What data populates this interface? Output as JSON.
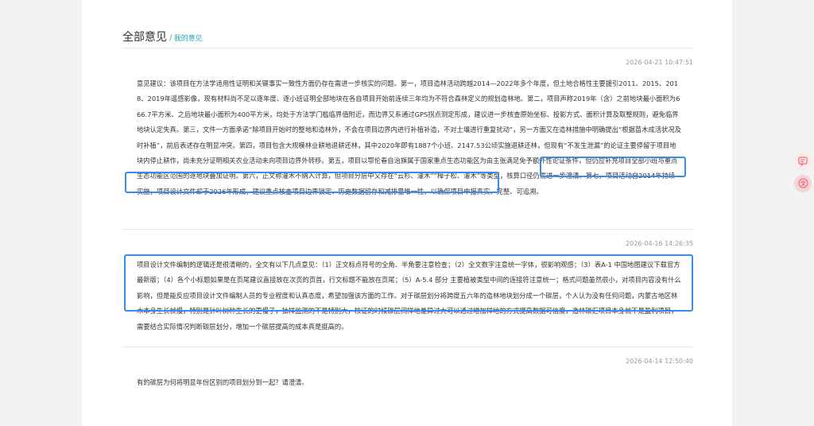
{
  "header": {
    "title": "全部意见",
    "separator": "/",
    "subtitle": "我的意见"
  },
  "opinions": [
    {
      "timestamp": "2026-04-21 10:47:51",
      "text": "意见建议：该项目在方法学适用性证明和关键事实一致性方面仍存在需进一步核实的问题。第一，项目造林活动跨越2014—2022年多个年度，但土地合格性主要援引2011、2015、2018、2019年遥感影像，现有材料尚不足以逐年度、逐小班证明全部地块在各自项目开始前连续三年均为不符合森林定义的规划造林地。第二，项目声称2019年（含）之前地块最小面积为666.7平方米、之后地块最小面积为400平方米，均处于方法学门槛临界值附近，而边界又系通过GPS拐点测定形成，建议进一步核查原始坐标、投影方式、面积计算及取整规则，避免临界地块认定失真。第三，文件一方面承诺“除项目开始时的整地和造林外，不会在项目边界内进行补植补造，不对土壤进行重复扰动”，另一方面又在造林措施中明确提出“根据苗木成活状况及时补植”，前后表述存在明显冲突。第四，项目包含大规模林业耕地退耕还林，其中2020年即有1887个小班、2147.53公顷实施退耕还林，但现有“不发生泄漏”的论证主要停留于项目地块内停止耕作，尚未充分证明相关农业活动未向项目边界外转移。第五，项目以鄂伦春自治旗属于国家重点生态功能区为由主张满足免予额外性论证条件，但仍应补充项目全部小班与重点生态功能区范围的逐地块叠加证明。第六，正文称灌木不纳入计算，但项目分层中又存在“云杉、灌木”“樟子松、灌木”等类型，核算口径仍需进一步澄清。第七，项目活动自2014年持续实施，项目设计文件却于2026年形成，建议重点核查项目边界锁定、历史数据留存和减排量唯一性，以确保项目申报真实、完整、可追溯。"
    },
    {
      "timestamp": "2026-04-16 14:26:35",
      "text": "项目设计文件编制的逻辑还是很清晰的，全文有以下几点意见：（1）正文标点符号的全角、半角要注意检查；（2）全文数字注意统一字体，很影响观感；（3）表A-1 中国地图建议下载官方最新版；（4）各个小标题如果是在页尾建议直接放在次页的页首，行文标题不能放在页尾；（5）A-5.4 部分 主要植被类型中间的连接符注意统一；格式问题虽然很小，对项目内容没有什么影响，但是能反应项目设计文件编制人员的专业程度和认真态度，希望加强该方面的工作。对于碳层划分将跨度五六年的造林地块划分成一个碳层，个人认为没有任何问题，内蒙古地区林木本身生长就慢，特别是针叶树种生长的更慢了，抽样监测的不是特别大，核证的时候碳层间样地差异过大可以通过增加样地的方式提高数据可信度，造林碳汇项目本身就不是盈利项目，需要结合实际情况判断碳层划分，增加一个碳层提高的成本真是挺高的。"
    },
    {
      "timestamp": "2026-04-14 12:50:40",
      "text": "有的碳层为何将明显年份区别的项目划分到一起？请澄清。"
    }
  ],
  "floating": {
    "btn1_icon": "feedback-icon",
    "btn2_icon": "translate-icon",
    "btn1_color": "#e8707a",
    "btn2_color": "#e8707a"
  },
  "colors": {
    "accent": "#1aa6b7",
    "highlight_box": "#3a8ee6"
  }
}
